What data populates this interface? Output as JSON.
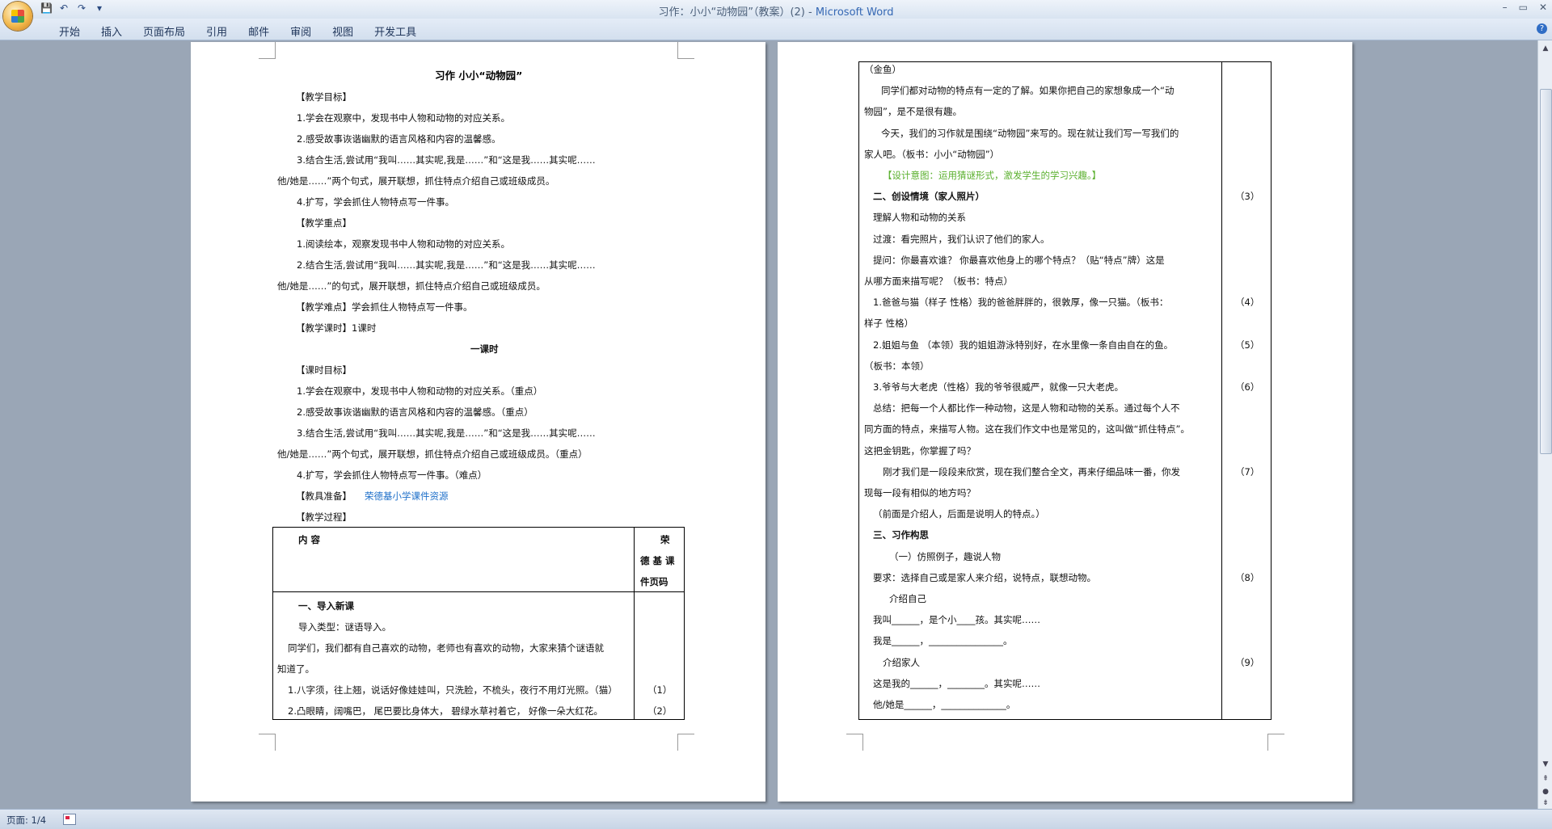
{
  "window": {
    "doc_title": "习作：小小“动物园”（教案）(2) - ",
    "app_name": "Microsoft Word"
  },
  "qat": {
    "save": "💾",
    "undo": "↶",
    "redo": "↷",
    "more": "▾"
  },
  "winctl": {
    "minimize": "–",
    "restore": "▭",
    "close": "✕"
  },
  "ribbon": {
    "tabs": [
      "开始",
      "插入",
      "页面布局",
      "引用",
      "邮件",
      "审阅",
      "视图",
      "开发工具"
    ],
    "help": "?"
  },
  "page1": {
    "title": "习作  小小“动物园”",
    "lines": [
      "【教学目标】",
      "1.学会在观察中，发现书中人物和动物的对应关系。",
      "2.感受故事诙谐幽默的语言风格和内容的温馨感。",
      "3.结合生活,尝试用“我叫……其实呢,我是……”和“这是我……其实呢……",
      "他/她是……”两个句式，展开联想，抓住特点介绍自己或班级成员。",
      "4.扩写，学会抓住人物特点写一件事。",
      "【教学重点】",
      "1.阅读绘本，观察发现书中人物和动物的对应关系。",
      "2.结合生活,尝试用“我叫……其实呢,我是……”和“这是我……其实呢……",
      "他/她是……”的句式，展开联想，抓住特点介绍自己或班级成员。",
      "【教学难点】学会抓住人物特点写一件事。",
      "【教学课时】1课时",
      "一课时",
      "【课时目标】",
      "1.学会在观察中，发现书中人物和动物的对应关系。（重点）",
      "2.感受故事诙谐幽默的语言风格和内容的温馨感。（重点）",
      "3.结合生活,尝试用“我叫……其实呢,我是……”和“这是我……其实呢……",
      "他/她是……”两个句式，展开联想，抓住特点介绍自己或班级成员。（重点）",
      "4.扩写，学会抓住人物特点写一件事。（难点）",
      "【教具准备】",
      "荣德基小学课件资源",
      "【教学过程】"
    ],
    "table": {
      "col1_header": "内  容",
      "col2_header": [
        "荣",
        "德 基 课",
        "件页码"
      ],
      "rows": [
        "一、导入新课",
        "导入类型：谜语导入。",
        "同学们，我们都有自己喜欢的动物，老师也有喜欢的动物，大家来猜个谜语就",
        "知道了。",
        "1.八字须，往上翘，说话好像娃娃叫，只洗脸，不梳头，夜行不用灯光照。（猫）",
        "2.凸眼睛，阔嘴巴， 尾巴要比身体大， 碧绿水草衬着它， 好像一朵大红花。"
      ],
      "pages": [
        "",
        "",
        "",
        "",
        "（1）",
        "（2）"
      ]
    }
  },
  "page2": {
    "rows": [
      {
        "text": "（金鱼）",
        "page": ""
      },
      {
        "text": "同学们都对动物的特点有一定的了解。如果你把自己的家想象成一个“动",
        "page": ""
      },
      {
        "text": "物园”，是不是很有趣。",
        "page": ""
      },
      {
        "text": "今天，我们的习作就是围绕“动物园”来写的。现在就让我们写一写我们的",
        "page": ""
      },
      {
        "text": "家人吧。（板书：小小“动物园”）",
        "page": ""
      },
      {
        "text": "【设计意图：运用猜谜形式，激发学生的学习兴趣。】",
        "page": ""
      },
      {
        "text": "二、创设情境（家人照片）",
        "page": "（3）"
      },
      {
        "text": "理解人物和动物的关系",
        "page": ""
      },
      {
        "text": "过渡：看完照片，我们认识了他们的家人。",
        "page": ""
      },
      {
        "text": "提问：你最喜欢谁？ 你最喜欢他身上的哪个特点？（贴“特点”牌）这是",
        "page": ""
      },
      {
        "text": "从哪方面来描写呢？（板书：特点）",
        "page": ""
      },
      {
        "text": "1.爸爸与猫（样子   性格）我的爸爸胖胖的，很敦厚，像一只猫。（板书：",
        "page": "（4）"
      },
      {
        "text": "样子   性格）",
        "page": ""
      },
      {
        "text": "2.姐姐与鱼 （本领）我的姐姐游泳特别好，在水里像一条自由自在的鱼。",
        "page": "（5）"
      },
      {
        "text": "（板书：本领）",
        "page": ""
      },
      {
        "text": "3.爷爷与大老虎（性格）我的爷爷很威严，就像一只大老虎。",
        "page": "（6）"
      },
      {
        "text": "总结：把每一个人都比作一种动物，这是人物和动物的关系。通过每个人不",
        "page": ""
      },
      {
        "text": "同方面的特点，来描写人物。这在我们作文中也是常见的，这叫做“抓住特点”。",
        "page": ""
      },
      {
        "text": "这把金钥匙，你掌握了吗？",
        "page": ""
      },
      {
        "text": "刚才我们是一段段来欣赏，现在我们整合全文，再来仔细品味一番，你发",
        "page": "（7）"
      },
      {
        "text": "现每一段有相似的地方吗？",
        "page": ""
      },
      {
        "text": "（前面是介绍人，后面是说明人的特点。）",
        "page": ""
      },
      {
        "text": "三、习作构思",
        "page": ""
      },
      {
        "text": "（一）仿照例子，趣说人物",
        "page": ""
      },
      {
        "text": "要求：选择自己或是家人来介绍，说特点，联想动物。",
        "page": "（8）"
      },
      {
        "text": "介绍自己",
        "page": ""
      },
      {
        "text": "我叫______，是个小____孩。其实呢……",
        "page": ""
      },
      {
        "text": "我是______，________________。",
        "page": ""
      },
      {
        "text": "介绍家人",
        "page": "（9）"
      },
      {
        "text": "这是我的______，________。其实呢……",
        "page": ""
      },
      {
        "text": "他/她是______，______________。",
        "page": ""
      }
    ]
  },
  "status": {
    "page": "页面: 1/4"
  }
}
